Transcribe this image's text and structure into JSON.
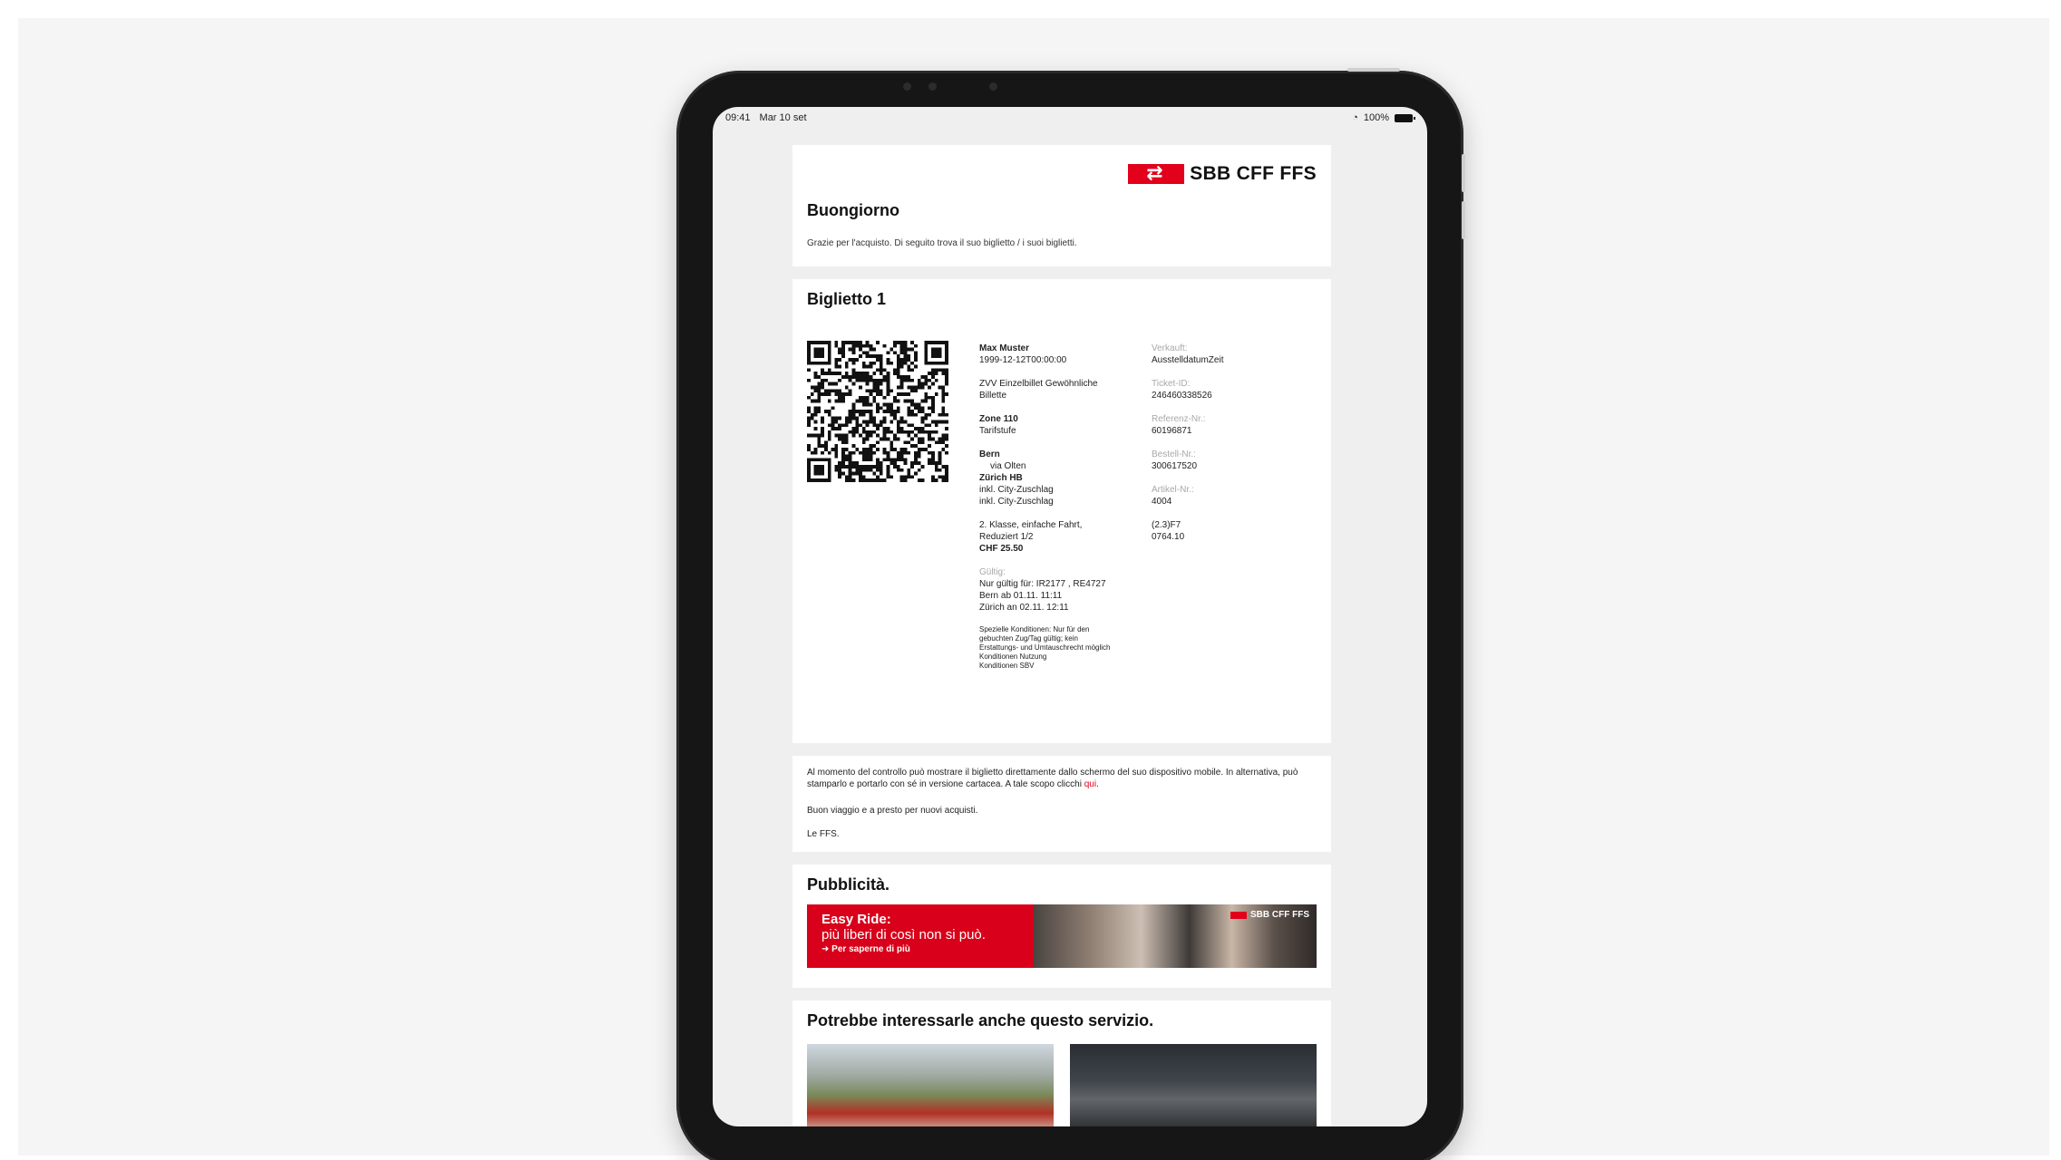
{
  "status_bar": {
    "time": "09:41",
    "date": "Mar 10 set",
    "battery": "100%"
  },
  "brand": {
    "logo_text": "SBB CFF FFS",
    "brand_red": "#e2001a"
  },
  "greeting": {
    "title": "Buongiorno",
    "intro": "Grazie per l'acquisto. Di seguito trova il suo biglietto / i suoi biglietti."
  },
  "ticket": {
    "title": "Biglietto 1",
    "passenger": {
      "name": "Max Muster",
      "birth": "1999-12-12T00:00:00"
    },
    "product": {
      "line1": "ZVV Einzelbillet Gewöhnliche",
      "line2": "Billette"
    },
    "zone": {
      "name": "Zone 110",
      "sub": "Tarifstufe"
    },
    "route": {
      "from": "Bern",
      "via": "via Olten",
      "to": "Zürich HB",
      "incl1": "inkl. City-Zuschlag",
      "incl2": "inkl. City-Zuschlag"
    },
    "fare": {
      "line1": "2. Klasse, einfache Fahrt,",
      "line2": "Reduziert 1/2",
      "price": "CHF 25.50"
    },
    "validity": {
      "label": "Gültig:",
      "line1": "Nur gültig für: IR2177 , RE4727",
      "line2": "Bern ab 01.11. 11:11",
      "line3": "Zürich an 02.11. 12:11"
    },
    "conditions": [
      "Spezielle Konditionen: Nur für den",
      "gebuchten Zug/Tag gültig; kein",
      "Erstattungs- und Umtauschrecht möglich",
      "Konditionen Nutzung",
      "Konditionen SBV"
    ],
    "meta": [
      {
        "label": "Verkauft:",
        "value": "AusstelldatumZeit"
      },
      {
        "label": "Ticket-ID:",
        "value": "246460338526"
      },
      {
        "label": "Referenz-Nr.:",
        "value": "60196871"
      },
      {
        "label": "Bestell-Nr.:",
        "value": "300617520"
      },
      {
        "label": "Artikel-Nr.:",
        "value": "4004"
      }
    ],
    "codes": {
      "line1": "(2.3)F7",
      "line2": "0764.10"
    }
  },
  "message": {
    "p1_before": "Al momento del controllo può mostrare il biglietto direttamente dallo schermo del suo dispositivo mobile. In alternativa, può stamparlo e portarlo con sé in versione cartacea. A tale scopo clicchi ",
    "p1_link": "qui",
    "p1_after": ".",
    "p2": "Buon viaggio e a presto per nuovi acquisti.",
    "p3": "Le FFS."
  },
  "advertising": {
    "title": "Pubblicità.",
    "banner_title": "Easy Ride:",
    "banner_subtitle": "più liberi di così non si può.",
    "banner_cta": "Per saperne di più",
    "banner_logo": "SBB CFF FFS"
  },
  "services": {
    "title": "Potrebbe interessarle anche questo servizio."
  }
}
